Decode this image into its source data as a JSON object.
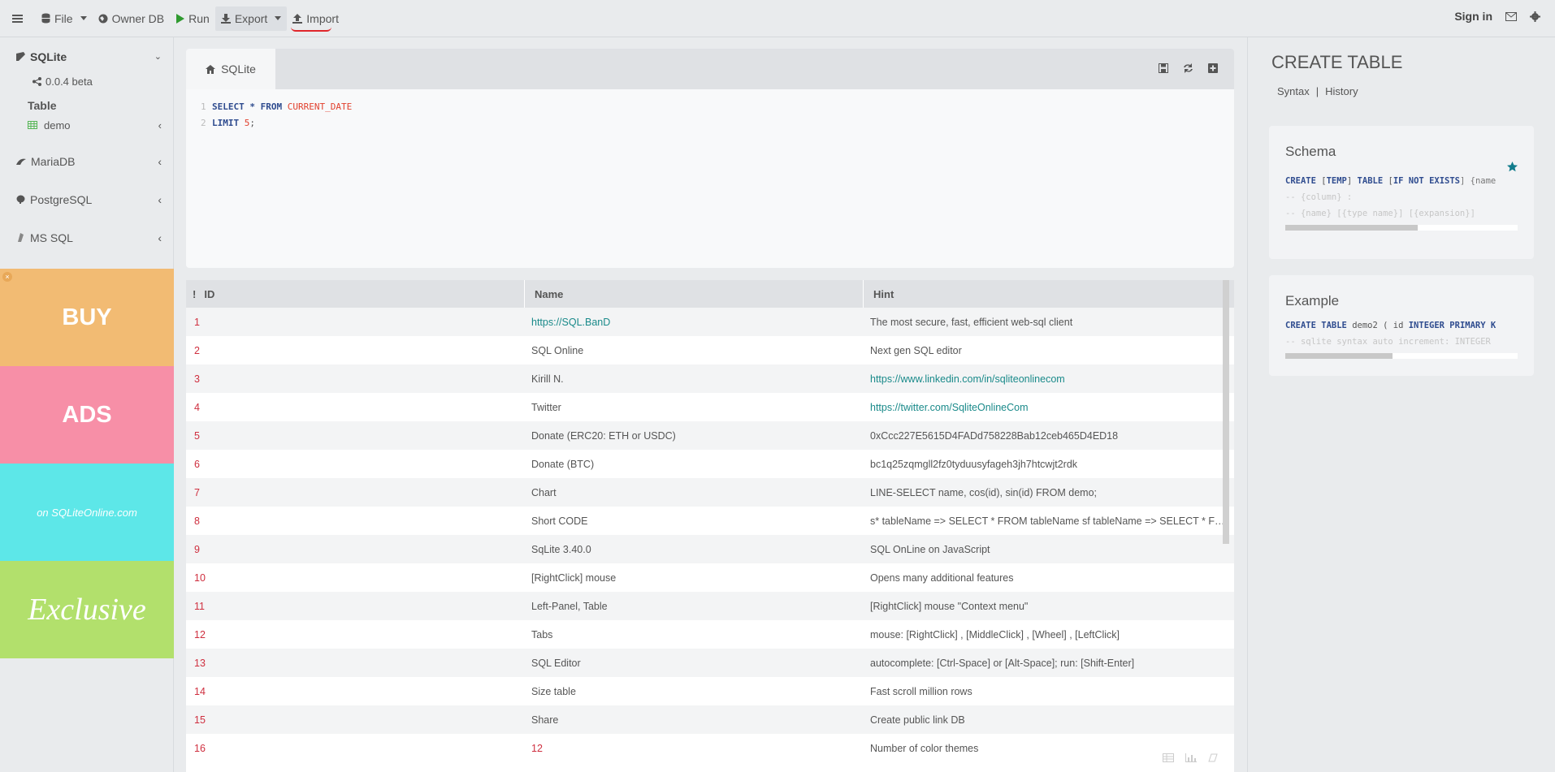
{
  "topbar": {
    "menu_icon": "hamburger-icon",
    "file": "File",
    "owner_db": "Owner DB",
    "run": "Run",
    "export": "Export",
    "import": "Import",
    "sign_in": "Sign in"
  },
  "sidebar": {
    "sqlite": {
      "label": "SQLite",
      "version": "0.0.4 beta",
      "section": "Table",
      "table": "demo"
    },
    "dbs": [
      {
        "label": "MariaDB"
      },
      {
        "label": "PostgreSQL"
      },
      {
        "label": "MS SQL"
      }
    ],
    "ads": {
      "buy": "BUY",
      "ads": "ADS",
      "site": "on SQLiteOnline.com",
      "exclusive": "Exclusive"
    }
  },
  "editor": {
    "tab": "SQLite",
    "lines": [
      {
        "n": "1",
        "k1": "SELECT",
        "star": " * ",
        "k2": "FROM",
        "fn": "CURRENT_DATE"
      },
      {
        "n": "2",
        "k1": "LIMIT",
        "num": "5",
        "end": ";"
      }
    ]
  },
  "grid": {
    "columns": [
      "ID",
      "Name",
      "Hint"
    ],
    "sort_marker": "!",
    "rows": [
      {
        "id": "1",
        "name": "https://SQL.BanD",
        "hint": "The most secure, fast, efficient web-sql client",
        "nl": true,
        "hl": false
      },
      {
        "id": "2",
        "name": "SQL Online",
        "hint": "Next gen SQL editor",
        "nl": false,
        "hl": false
      },
      {
        "id": "3",
        "name": "Kirill N.",
        "hint": "https://www.linkedin.com/in/sqliteonlinecom",
        "nl": false,
        "hl": true
      },
      {
        "id": "4",
        "name": "Twitter",
        "hint": "https://twitter.com/SqliteOnlineCom",
        "nl": false,
        "hl": true
      },
      {
        "id": "5",
        "name": "Donate (ERC20: ETH or USDC)",
        "hint": "0xCcc227E5615D4FADd758228Bab12ceb465D4ED18",
        "nl": false,
        "hl": false
      },
      {
        "id": "6",
        "name": "Donate (BTC)",
        "hint": "bc1q25zqmgll2fz0tyduusyfageh3jh7htcwjt2rdk",
        "nl": false,
        "hl": false
      },
      {
        "id": "7",
        "name": "Chart",
        "hint": "LINE-SELECT name, cos(id), sin(id) FROM demo;",
        "nl": false,
        "hl": false
      },
      {
        "id": "8",
        "name": "Short CODE",
        "hint": "s* tableName => SELECT * FROM tableName sf tableName => SELECT * FROM tableName",
        "nl": false,
        "hl": false
      },
      {
        "id": "9",
        "name": "SqLite 3.40.0",
        "hint": "SQL OnLine on JavaScript",
        "nl": false,
        "hl": false
      },
      {
        "id": "10",
        "name": "[RightClick] mouse",
        "hint": "Opens many additional features",
        "nl": false,
        "hl": false
      },
      {
        "id": "11",
        "name": "Left-Panel, Table",
        "hint": "[RightClick] mouse \"Context menu\"",
        "nl": false,
        "hl": false
      },
      {
        "id": "12",
        "name": "Tabs",
        "hint": "mouse: [RightClick] , [MiddleClick] , [Wheel] , [LeftClick]",
        "nl": false,
        "hl": false
      },
      {
        "id": "13",
        "name": "SQL Editor",
        "hint": "autocomplete: [Ctrl-Space] or [Alt-Space]; run: [Shift-Enter]",
        "nl": false,
        "hl": false
      },
      {
        "id": "14",
        "name": "Size table",
        "hint": "Fast scroll million rows",
        "nl": false,
        "hl": false
      },
      {
        "id": "15",
        "name": "Share",
        "hint": "Create public link DB",
        "nl": false,
        "hl": false
      },
      {
        "id": "16",
        "name": "12",
        "hint": "Number of color themes",
        "nl": false,
        "hl": false,
        "red": true
      }
    ]
  },
  "right": {
    "title": "CREATE TABLE",
    "syntax": "Syntax",
    "sep": "|",
    "history": "History",
    "schema": {
      "title": "Schema",
      "l1a": "CREATE",
      "l1b": " [",
      "l1c": "TEMP",
      "l1d": "] ",
      "l1e": "TABLE",
      "l1f": " [",
      "l1g": "IF NOT EXISTS",
      "l1h": "] {name",
      "l2": "-- {column} :",
      "l3": "-- {name} [{type name}] [{expansion}]",
      "progress": 0.57
    },
    "example": {
      "title": "Example",
      "l1a": "CREATE",
      "l1b": " ",
      "l1c": "TABLE",
      "l1d": " demo2 ( id ",
      "l1e": "INTEGER PRIMARY",
      "l1f": " K",
      "l2": "-- sqlite syntax auto increment: INTEGER",
      "progress": 0.46
    }
  },
  "colors": {
    "accent": "#1a8a8a",
    "red": "#cf2f3f",
    "buy": "#f2bb73",
    "ads": "#f78fa7",
    "site": "#5de7e8",
    "exclusive": "#b2e06c"
  }
}
